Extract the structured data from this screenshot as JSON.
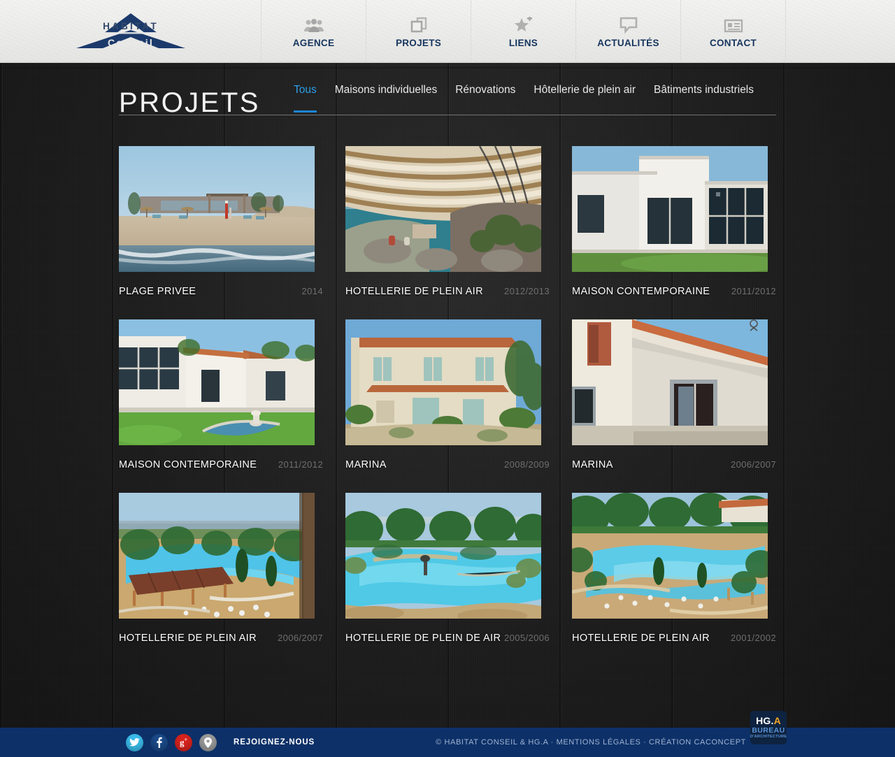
{
  "header": {
    "logo": {
      "name": "HABITAT",
      "sub": "Conseil"
    },
    "nav": [
      {
        "label": "AGENCE",
        "icon": "people-icon"
      },
      {
        "label": "PROJETS",
        "icon": "pages-icon"
      },
      {
        "label": "LIENS",
        "icon": "star-plus-icon"
      },
      {
        "label": "ACTUALITÉS",
        "icon": "speech-bubble-icon"
      },
      {
        "label": "CONTACT",
        "icon": "contact-card-icon"
      }
    ]
  },
  "main": {
    "title": "PROJETS",
    "filters": [
      {
        "label": "Tous",
        "active": true
      },
      {
        "label": "Maisons individuelles",
        "active": false
      },
      {
        "label": "Rénovations",
        "active": false
      },
      {
        "label": "Hôtellerie de plein air",
        "active": false
      },
      {
        "label": "Bâtiments industriels",
        "active": false
      }
    ],
    "projects": [
      {
        "title": "PLAGE PRIVEE",
        "year": "2014",
        "image": "beach-pavilion"
      },
      {
        "title": "HOTELLERIE DE PLEIN AIR",
        "year": "2012/2013",
        "image": "wooden-canopy-pool"
      },
      {
        "title": "MAISON CONTEMPORAINE",
        "year": "2011/2012",
        "image": "white-modern-house"
      },
      {
        "title": "MAISON CONTEMPORAINE",
        "year": "2011/2012",
        "image": "modern-house-lawn"
      },
      {
        "title": "MARINA",
        "year": "2008/2009",
        "image": "provencal-villa"
      },
      {
        "title": "MARINA",
        "year": "2006/2007",
        "image": "villa-terracotta-roof"
      },
      {
        "title": "HOTELLERIE DE PLEIN AIR",
        "year": "2006/2007",
        "image": "campsite-pool-aerial"
      },
      {
        "title": "HOTELLERIE DE PLEIN DE AIR",
        "year": "2005/2006",
        "image": "lagoon-pool"
      },
      {
        "title": "HOTELLERIE DE PLEIN AIR",
        "year": "2001/2002",
        "image": "resort-pool-aerial"
      }
    ]
  },
  "footer": {
    "social": [
      {
        "name": "twitter",
        "glyph": "t"
      },
      {
        "name": "facebook",
        "glyph": "f"
      },
      {
        "name": "google-plus",
        "glyph": "g"
      },
      {
        "name": "location",
        "glyph": "p"
      }
    ],
    "join_label": "REJOIGNEZ-NOUS",
    "copyright": "© HABITAT CONSEIL & HG.A  · MENTIONS LÉGALES · CRÉATION CACONCEPT",
    "hga": {
      "line1a": "HG.",
      "line1b": "A",
      "line2": "BUREAU",
      "line3": "D'ARCHITECTURE"
    }
  },
  "colors": {
    "accent_blue": "#2a9fe8",
    "nav_navy": "#16355e",
    "footer_navy": "#0d3068",
    "page_dark": "#232323"
  }
}
